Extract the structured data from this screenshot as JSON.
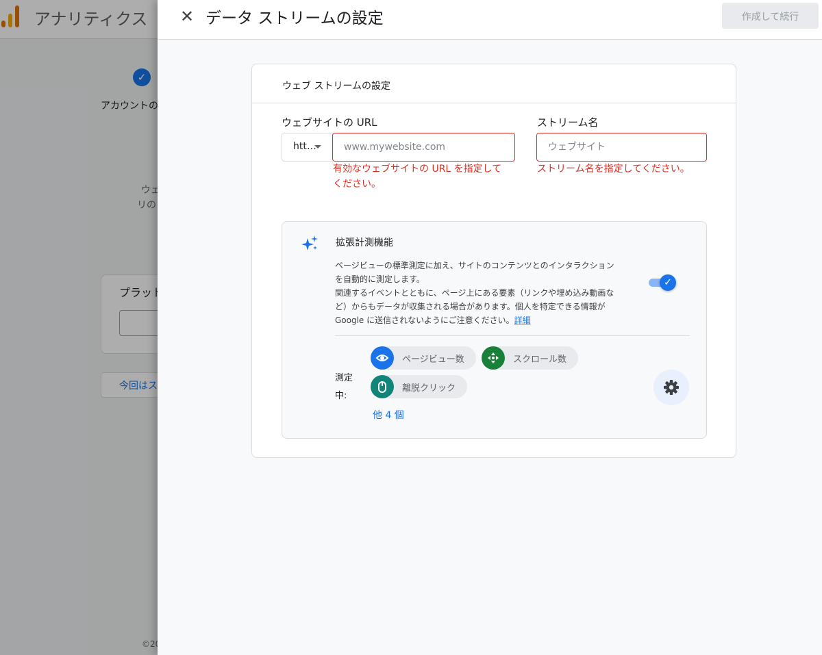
{
  "background": {
    "app_title": "アナリティクス",
    "step_label": "アカウントの",
    "text_line1": "ウェ",
    "text_line2": "リの",
    "card_title": "プラット",
    "button_label": "今回はス",
    "footer": "©20"
  },
  "header": {
    "close_icon": "close-icon",
    "title": "データ ストリームの設定",
    "create_button": "作成して続行"
  },
  "card": {
    "title": "ウェブ ストリームの設定",
    "url_label": "ウェブサイトの URL",
    "protocol_value": "htt…",
    "url_placeholder": "www.mywebsite.com",
    "url_error_line1": "有効なウェブサイトの URL を指定して",
    "url_error_line2": "ください。",
    "stream_label": "ストリーム名",
    "stream_placeholder": "ウェブサイト",
    "stream_error": "ストリーム名を指定してください。"
  },
  "enhanced_measurement": {
    "title": "拡張計測機能",
    "desc_lines": [
      "ページビューの標準測定に加え、サイトのコンテンツとのインタラクション",
      "を自動的に測定します。",
      "関連するイベントとともに、ページ上にある要素（リンクや埋め込み動画な",
      "ど）からもデータが収集される場合があります。個人を特定できる情報が"
    ],
    "desc_last": "Google に送信されないようにご注意ください。",
    "details_link": "詳細",
    "toggle_on": true,
    "measuring_label_1": "測定",
    "measuring_label_2": "中:",
    "chips": [
      {
        "label": "ページビュー数",
        "icon": "eye-icon",
        "color": "#1a73e8"
      },
      {
        "label": "スクロール数",
        "icon": "scroll-arrows-icon",
        "color": "#188038"
      },
      {
        "label": "離脱クリック",
        "icon": "mouse-icon",
        "color": "#12857a"
      }
    ],
    "more_link": "他 4 個",
    "settings_icon": "gear-icon"
  },
  "colors": {
    "accent": "#1a73e8",
    "error": "#d93025"
  }
}
